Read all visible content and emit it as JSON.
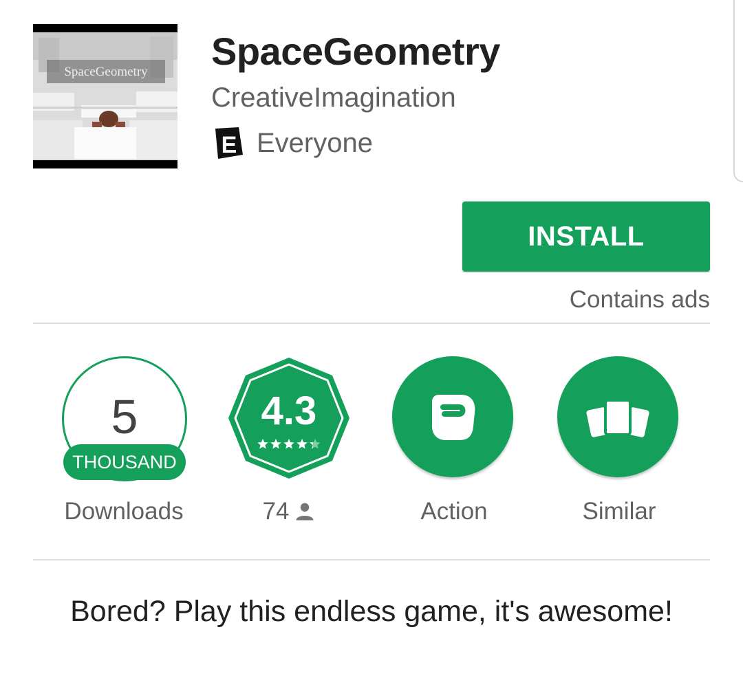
{
  "app": {
    "title": "SpaceGeometry",
    "icon_caption": "SpaceGeometry",
    "developer": "CreativeImagination",
    "content_rating": "Everyone",
    "content_rating_badge": "E"
  },
  "install": {
    "label": "INSTALL",
    "ads_notice": "Contains ads"
  },
  "stats": {
    "downloads": {
      "value": "5",
      "unit": "THOUSAND",
      "label": "Downloads"
    },
    "rating": {
      "value": "4.3",
      "stars_filled": 4.3,
      "stars_total": 5,
      "count": "74"
    },
    "genre": {
      "label": "Action",
      "icon": "fist-icon"
    },
    "similar": {
      "label": "Similar",
      "icon": "cards-icon"
    }
  },
  "description": "Bored? Play this endless game, it's awesome!",
  "colors": {
    "accent": "#14a05a",
    "text_primary": "#212121",
    "text_secondary": "#616161",
    "divider": "#dedede"
  }
}
